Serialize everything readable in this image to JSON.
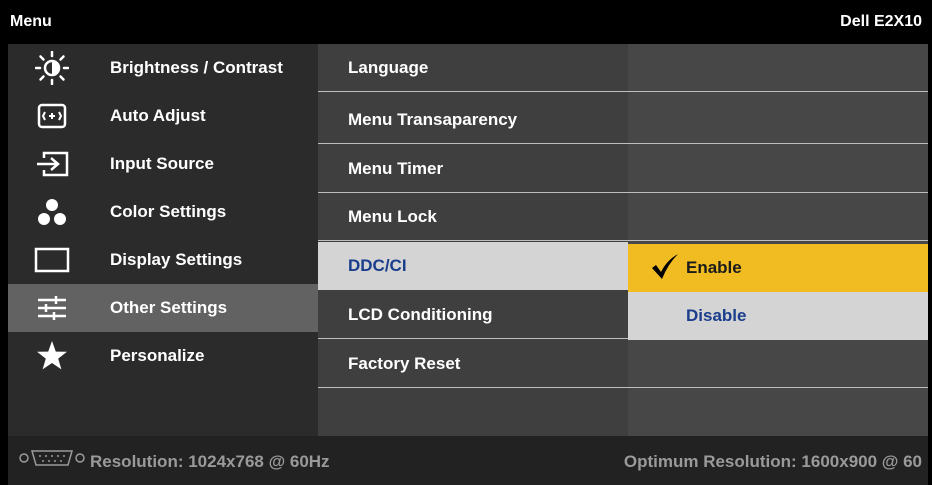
{
  "header": {
    "title": "Menu",
    "model": "Dell E2X10"
  },
  "sidebar": {
    "items": [
      {
        "label": "Brightness / Contrast",
        "icon": "brightness-icon"
      },
      {
        "label": "Auto Adjust",
        "icon": "auto-adjust-icon"
      },
      {
        "label": "Input Source",
        "icon": "input-source-icon"
      },
      {
        "label": "Color Settings",
        "icon": "color-settings-icon"
      },
      {
        "label": "Display Settings",
        "icon": "display-settings-icon"
      },
      {
        "label": "Other Settings",
        "icon": "sliders-icon",
        "selected": true
      },
      {
        "label": "Personalize",
        "icon": "star-icon"
      }
    ]
  },
  "submenu": {
    "items": [
      {
        "label": "Language"
      },
      {
        "label": "Menu Transaparency"
      },
      {
        "label": "Menu Timer"
      },
      {
        "label": "Menu Lock"
      },
      {
        "label": "DDC/CI",
        "highlighted": true
      },
      {
        "label": "LCD Conditioning"
      },
      {
        "label": "Factory Reset"
      }
    ]
  },
  "options": {
    "enable": "Enable",
    "disable": "Disable",
    "selected": "Enable"
  },
  "status": {
    "resolution": "Resolution: 1024x768 @ 60Hz",
    "optimum": "Optimum Resolution: 1600x900 @ 60"
  },
  "colors": {
    "selected_option": "#f1bc22",
    "highlight_row": "#d4d4d4",
    "highlight_text": "#1a3d8c"
  }
}
